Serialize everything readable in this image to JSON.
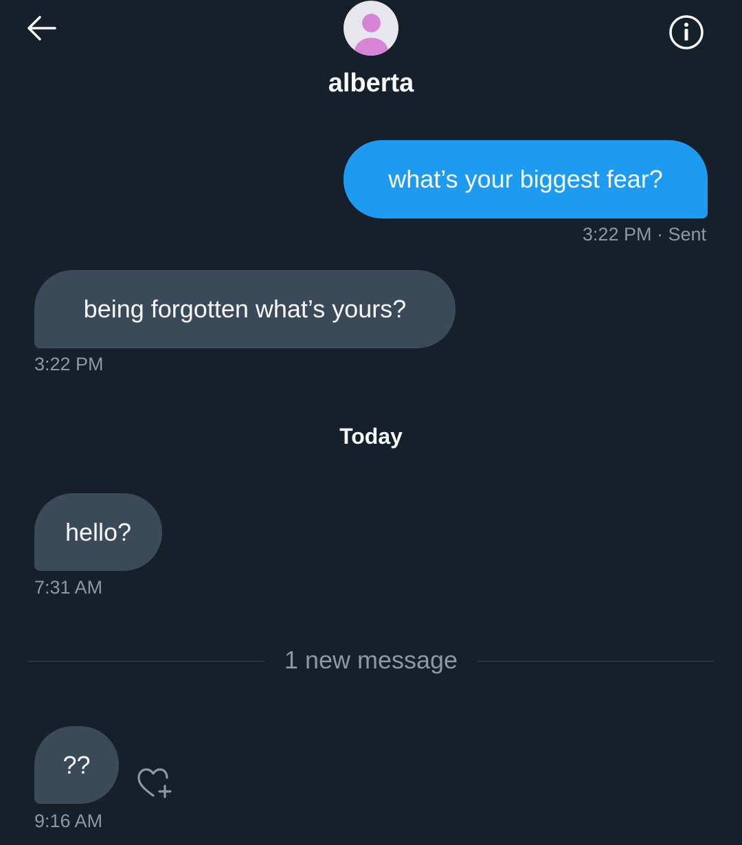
{
  "header": {
    "back_icon": "arrow-left-icon",
    "contact_name": "alberta",
    "info_icon": "info-circle-icon",
    "avatar_colors": {
      "background": "#e6e6ec",
      "figure": "#d884d6"
    }
  },
  "colors": {
    "background": "#15202b",
    "sent_bubble": "#1d9bf0",
    "received_bubble": "#3b4a59",
    "meta_text": "#8b98a5"
  },
  "messages": [
    {
      "direction": "sent",
      "text": "what’s your biggest fear?",
      "time": "3:22 PM",
      "status": "· Sent",
      "meta": "3:22 PM · Sent"
    },
    {
      "direction": "received",
      "text": "being forgotten what’s yours?",
      "time": "3:22 PM"
    },
    {
      "direction": "received",
      "text": "hello?",
      "time": "7:31 AM"
    },
    {
      "direction": "received",
      "text": "??",
      "time": "9:16 AM"
    }
  ],
  "day_separator": "Today",
  "new_message_divider": "1 new message",
  "reaction_icon": "heart-plus-icon"
}
